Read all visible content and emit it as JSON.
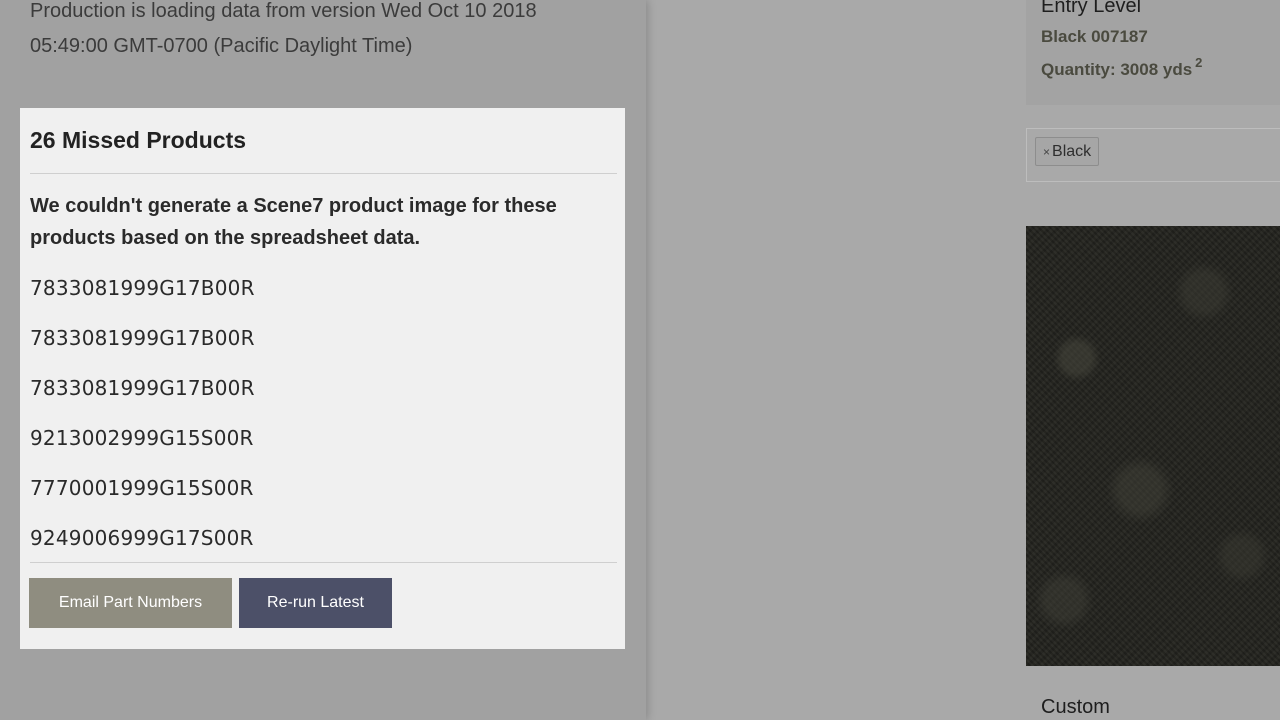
{
  "background": {
    "loading_message": "Production is loading data from version Wed Oct 10 2018 05:49:00 GMT-0700 (Pacific Daylight Time)"
  },
  "modal": {
    "title": "26 Missed Products",
    "description": "We couldn't generate a Scene7 product image for these products based on the spreadsheet data.",
    "products": [
      "7833081999G17B00R",
      "7833081999G17B00R",
      "7833081999G17B00R",
      "9213002999G15S00R",
      "7770001999G15S00R",
      "9249006999G17S00R"
    ],
    "email_button_label": "Email Part Numbers",
    "rerun_button_label": "Re-run Latest"
  },
  "product_card": {
    "level": "Entry Level",
    "color": "Black 007187",
    "quantity_label": "Quantity: 3008 yds",
    "quantity_superscript": "2"
  },
  "filter": {
    "tag_remove_symbol": "×",
    "tag_label": "Black"
  },
  "bottom_label": "Custom",
  "colors": {
    "email_button": "#8f8d80",
    "rerun_button": "#4c5068",
    "modal_background": "#f0f0f0",
    "swatch": "#22221d"
  }
}
